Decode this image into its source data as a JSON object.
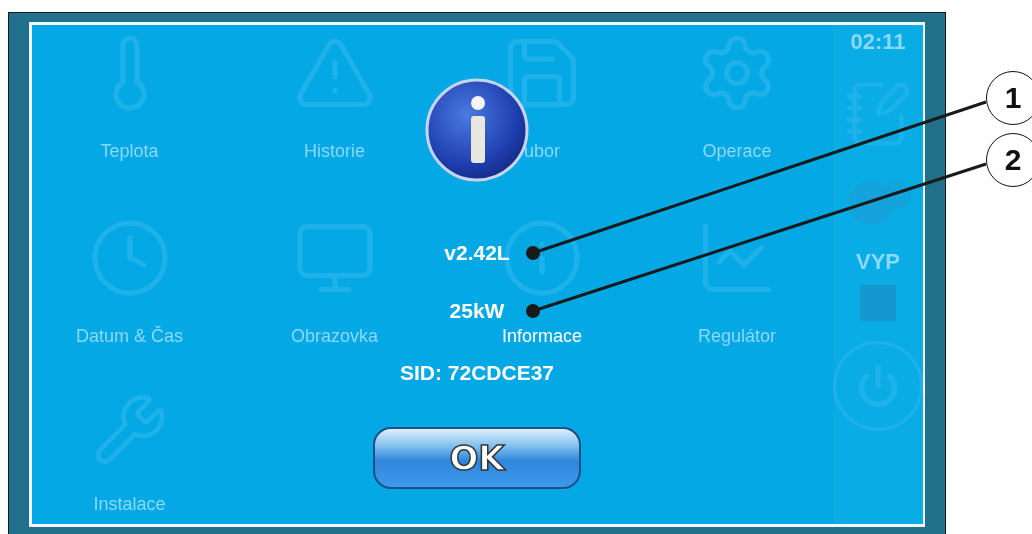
{
  "tiles": [
    {
      "label": "Teplota",
      "kind": "thermometer",
      "selected": false
    },
    {
      "label": "Historie",
      "kind": "warning",
      "selected": false
    },
    {
      "label": "ubor",
      "kind": "floppy",
      "selected": false
    },
    {
      "label": "Operace",
      "kind": "gear",
      "selected": false
    },
    {
      "label": "Datum & Čas",
      "kind": "clock",
      "selected": false
    },
    {
      "label": "Obrazovka",
      "kind": "monitor",
      "selected": false
    },
    {
      "label": "Informace",
      "kind": "info",
      "selected": true
    },
    {
      "label": "Regulátor",
      "kind": "chart",
      "selected": false
    },
    {
      "label": "Instalace",
      "kind": "tools",
      "selected": false
    }
  ],
  "sidebar": {
    "time": "02:11",
    "mode": "VYP"
  },
  "dialog": {
    "lines": [
      "v2.42L",
      "25kW",
      "SID: 72CDCE37"
    ],
    "button": "OK"
  },
  "callouts": [
    "1",
    "2"
  ]
}
